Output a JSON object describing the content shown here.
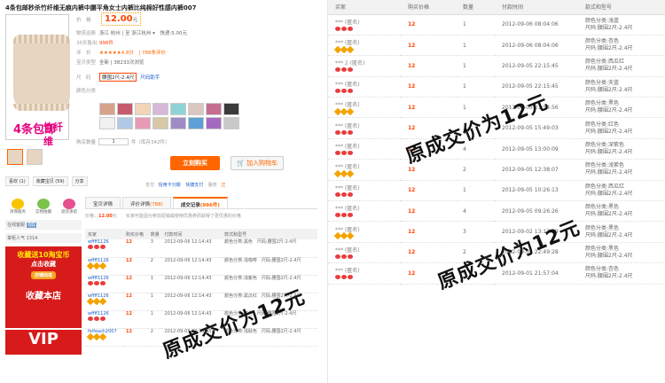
{
  "product": {
    "title": "4条包邮秒杀竹纤维无痕内裤中腰平角女士内裤比纯棉好性感内裤007",
    "promo_text_1": "4条包邮",
    "promo_text_2": "竹纤维",
    "price_label": "价　格",
    "price": "12.00",
    "price_unit": "元",
    "shipping_label": "物流运费",
    "shipping_value": "浙江 杭州 | 至 浙江杭州 ▾　快递:5.00元",
    "sold_label": "30天售出",
    "sold_value": "996件",
    "rating_label": "评　价",
    "rating_value": "★★★★★4.8分　| 788条评价",
    "service_label": "宝贝类型",
    "service_value": "全新 | 38233次浏览",
    "size_label": "尺　码",
    "size_selected": "腰围2尺-2.4尺",
    "size_helper": "尺码助手",
    "color_label": "颜色分类",
    "qty_label": "购买数量",
    "qty_value": "1",
    "qty_stock": "件（库存342件）",
    "buy_button": "立刻购买",
    "cart_button": "加入购物车",
    "pay_label": "支付",
    "pay_methods": [
      "信用卡分期",
      "快捷支付"
    ],
    "service_tag_label": "服务",
    "service_tag_value": "正",
    "fav_buttons": [
      "喜欢 (1)",
      "收藏宝贝 (59)",
      "分享"
    ]
  },
  "swatch_colors": [
    "#d8a18a",
    "#c85a6f",
    "#f3d4b6",
    "#d8b8d8",
    "#8fd4d4",
    "#d9c7c0",
    "#c66e8f",
    "#3a3a3a",
    "#f0f0f0",
    "#b2c9e6",
    "#e79ab6",
    "#d7c8a6",
    "#9f8cc4",
    "#5da0d5",
    "#a56ac0",
    "#c9c9c9"
  ],
  "sidebar": {
    "icons": [
      "消保服务",
      "实物拍摄",
      "退货承诺"
    ],
    "online_label": "在线客服",
    "online_qq": "QQ",
    "fans_label": "掌柜人气",
    "fans_value": "1314",
    "banner_line1": "收藏送10淘宝币",
    "banner_line2": "点击收藏",
    "banner_button": "店铺动态",
    "banner_line3": "收藏本店",
    "vip": "VIP"
  },
  "tabs": {
    "items": [
      {
        "label": "宝贝详情",
        "count": ""
      },
      {
        "label": "评价详情",
        "count": "(788)"
      },
      {
        "label": "成交记录",
        "count": "(996件)"
      }
    ],
    "sub_info_prefix": "价格：",
    "sub_info_price": "12.00",
    "sub_info_suffix": "元　　买家可能因为参加促销或使用优惠券而获得了更优惠的价格"
  },
  "record_headers": [
    "买家",
    "购买价格",
    "数量",
    "付款时间",
    "款式和型号"
  ],
  "left_records": [
    {
      "buyer": "wffff1126",
      "price": "12",
      "qty": "3",
      "time": "2012-09-06 12:14:43",
      "style": "颜色分类:黑色　尺码:腰围2尺-2.4尺"
    },
    {
      "buyer": "wffff1126",
      "price": "12",
      "qty": "2",
      "time": "2012-09-06 12:14:43",
      "style": "颜色分类:浅咖啡　尺码:腰围2尺-2.4尺"
    },
    {
      "buyer": "wffff1126",
      "price": "12",
      "qty": "1",
      "time": "2012-09-06 12:14:43",
      "style": "颜色分类:浅紫色　尺码:腰围2尺-2.4尺"
    },
    {
      "buyer": "wffff1126",
      "price": "12",
      "qty": "1",
      "time": "2012-09-06 12:14:43",
      "style": "颜色分类:黑瓜红　尺码:腰围2尺-2.4尺"
    },
    {
      "buyer": "wffff1126",
      "price": "12",
      "qty": "1",
      "time": "2012-09-06 12:14:43",
      "style": "颜色分类:红色　尺码:腰围2尺-2.4尺"
    },
    {
      "buyer": "feifeash2007",
      "price": "12",
      "qty": "2",
      "time": "2012-09-05 22:15:45",
      "style": "颜色分类:浅肤色　尺码:腰围2尺-2.4尺"
    }
  ],
  "right_records": [
    {
      "buyer": "*** (匿名)",
      "price": "12",
      "qty": "1",
      "time": "2012-09-06 08:04:06",
      "style": [
        "颜色分类:浅蓝",
        "尺码:腰围2尺-2.4尺"
      ]
    },
    {
      "buyer": "*** (匿名)",
      "price": "12",
      "qty": "1",
      "time": "2012-09-06 08:04:06",
      "style": [
        "颜色分类:杏色",
        "尺码:腰围2尺-2.4尺"
      ]
    },
    {
      "buyer": "*** 2 (匿名)",
      "price": "12",
      "qty": "1",
      "time": "2012-09-05 22:15:45",
      "style": [
        "颜色分类:西瓜红",
        "尺码:腰围2尺-2.4尺"
      ]
    },
    {
      "buyer": "*** (匿名)",
      "price": "12",
      "qty": "1",
      "time": "2012-09-05 22:15:45",
      "style": [
        "颜色分类:天蓝",
        "尺码:腰围2尺-2.4尺"
      ]
    },
    {
      "buyer": "*** (匿名)",
      "price": "12",
      "qty": "1",
      "time": "2012-09-05 21:54:56",
      "style": [
        "颜色分类:黑色",
        "尺码:腰围2尺-2.4尺"
      ]
    },
    {
      "buyer": "*** (匿名)",
      "price": "12",
      "qty": "1",
      "time": "2012-09-05 15:49:03",
      "style": [
        "颜色分类:红色",
        "尺码:腰围2尺-2.4尺"
      ]
    },
    {
      "buyer": "*** (匿名)",
      "price": "12",
      "qty": "4",
      "time": "2012-09-05 13:00:09",
      "style": [
        "颜色分类:深紫色",
        "尺码:腰围2尺-2.4尺"
      ]
    },
    {
      "buyer": "*** (匿名)",
      "price": "12",
      "qty": "2",
      "time": "2012-09-05 12:38:07",
      "style": [
        "颜色分类:浅紫色",
        "尺码:腰围2尺-2.4尺"
      ]
    },
    {
      "buyer": "*** (匿名)",
      "price": "12",
      "qty": "1",
      "time": "2012-09-05 10:26:13",
      "style": [
        "颜色分类:西瓜红",
        "尺码:腰围2尺-2.4尺"
      ]
    },
    {
      "buyer": "*** (匿名)",
      "price": "12",
      "qty": "4",
      "time": "2012-09-05 09:26:26",
      "style": [
        "颜色分类:黑色",
        "尺码:腰围2尺-2.4尺"
      ]
    },
    {
      "buyer": "*** (匿名)",
      "price": "12",
      "qty": "3",
      "time": "2012-09-02 13:17:29",
      "style": [
        "颜色分类:黑色",
        "尺码:腰围2尺-2.4尺"
      ]
    },
    {
      "buyer": "*** (匿名)",
      "price": "12",
      "qty": "2",
      "time": "2012-09-01 22:49:28",
      "style": [
        "颜色分类:黑色",
        "尺码:腰围2尺-2.4尺"
      ]
    },
    {
      "buyer": "*** (匿名)",
      "price": "12",
      "qty": "4",
      "time": "2012-09-01 21:57:04",
      "style": [
        "颜色分类:杏色",
        "尺码:腰围2尺-2.4尺"
      ]
    }
  ],
  "watermarks": [
    "原成交价为12元",
    "原成交价为12元",
    "原成交价为12元"
  ]
}
